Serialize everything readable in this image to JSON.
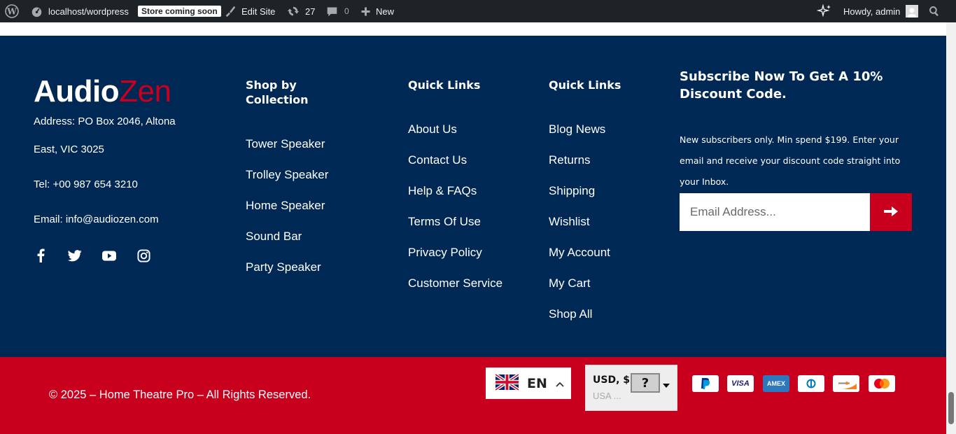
{
  "admin_bar": {
    "site": "localhost/wordpress",
    "store_badge": "Store coming soon",
    "edit_site": "Edit Site",
    "updates_count": "27",
    "comments_count": "0",
    "new_label": "New",
    "howdy": "Howdy, admin"
  },
  "footer": {
    "logo": {
      "part1": "Audio",
      "part2": "Zen"
    },
    "address_line1": "Address: PO Box 2046, Altona",
    "address_line2": "East, VIC 3025",
    "tel": "Tel: +00 987 654 3210",
    "email": "Email: info@audiozen.com",
    "socials": [
      "facebook-icon",
      "twitter-icon",
      "youtube-icon",
      "instagram-icon"
    ],
    "collection": {
      "title": "Shop by Collection",
      "links": [
        "Tower Speaker",
        "Trolley Speaker",
        "Home Speaker",
        "Sound Bar",
        "Party Speaker"
      ]
    },
    "quick_links_1": {
      "title": "Quick Links",
      "links": [
        "About Us",
        "Contact Us",
        "Help & FAQs",
        "Terms Of Use",
        "Privacy Policy",
        "Customer Service"
      ]
    },
    "quick_links_2": {
      "title": "Quick Links",
      "links": [
        "Blog News",
        "Returns",
        "Shipping",
        "Wishlist",
        "My Account",
        "My Cart",
        "Shop All"
      ]
    },
    "subscribe": {
      "title": "Subscribe Now To Get A 10% Discount Code.",
      "text": "New subscribers only. Min spend $199. Enter your email and receive your discount code straight into your Inbox.",
      "placeholder": "Email Address..."
    }
  },
  "bottom": {
    "copyright": "© 2025 – Home Theatre Pro – All Rights Reserved.",
    "language": "EN",
    "currency": "USD, $",
    "currency_sub": "USA ...",
    "payments": [
      "PayPal",
      "VISA",
      "AMEX",
      "Diners",
      "Discover",
      "Mastercard"
    ]
  },
  "colors": {
    "admin_bar": "#1d2327",
    "footer_bg": "#002855",
    "accent_red": "#c8001e"
  }
}
